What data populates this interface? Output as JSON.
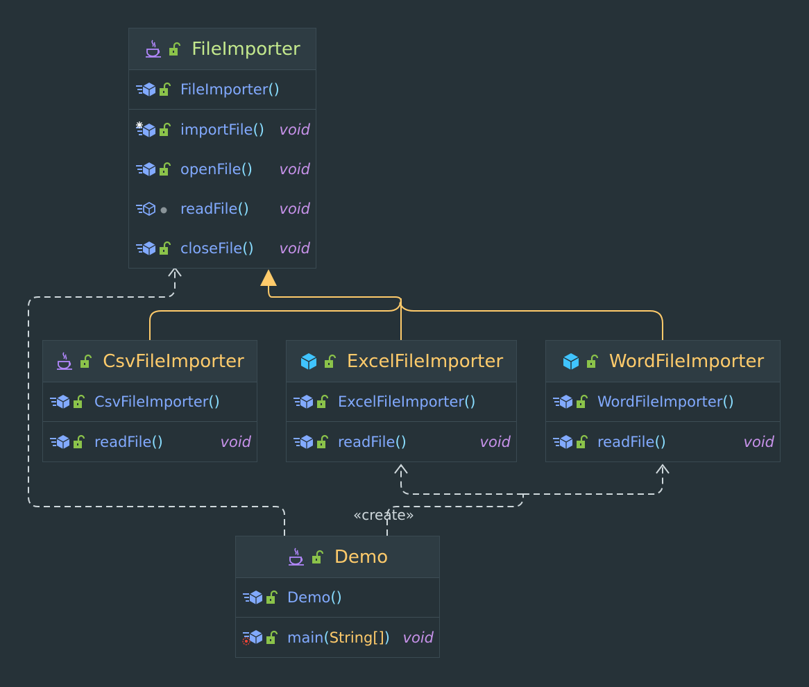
{
  "diagram": {
    "nodes": [
      {
        "id": "fileimporter",
        "name": "FileImporter",
        "kind": "abstract-class",
        "title_icon": "java-class-icon",
        "constructors": [
          {
            "name": "FileImporter",
            "params": "",
            "return": "",
            "method_icon": "method-icon",
            "visibility_icon": "public-lock-icon"
          }
        ],
        "methods": [
          {
            "name": "importFile",
            "params": "",
            "return": "void",
            "method_icon": "final-method-icon",
            "visibility_icon": "public-lock-icon"
          },
          {
            "name": "openFile",
            "params": "",
            "return": "void",
            "method_icon": "method-icon",
            "visibility_icon": "public-lock-icon"
          },
          {
            "name": "readFile",
            "params": "",
            "return": "void",
            "method_icon": "abstract-method-icon",
            "visibility_icon": "package-dot-icon"
          },
          {
            "name": "closeFile",
            "params": "",
            "return": "void",
            "method_icon": "method-icon",
            "visibility_icon": "public-lock-icon"
          }
        ]
      },
      {
        "id": "csvfileimporter",
        "name": "CsvFileImporter",
        "kind": "class",
        "title_icon": "java-class-icon",
        "constructors": [
          {
            "name": "CsvFileImporter",
            "params": "",
            "return": "",
            "method_icon": "method-icon",
            "visibility_icon": "public-lock-icon"
          }
        ],
        "methods": [
          {
            "name": "readFile",
            "params": "",
            "return": "void",
            "method_icon": "method-icon",
            "visibility_icon": "public-lock-icon"
          }
        ]
      },
      {
        "id": "excelfileimporter",
        "name": "ExcelFileImporter",
        "kind": "class",
        "title_icon": "class-cube-icon",
        "constructors": [
          {
            "name": "ExcelFileImporter",
            "params": "",
            "return": "",
            "method_icon": "method-icon",
            "visibility_icon": "public-lock-icon"
          }
        ],
        "methods": [
          {
            "name": "readFile",
            "params": "",
            "return": "void",
            "method_icon": "method-icon",
            "visibility_icon": "public-lock-icon"
          }
        ]
      },
      {
        "id": "wordfileimporter",
        "name": "WordFileImporter",
        "kind": "class",
        "title_icon": "class-cube-icon",
        "constructors": [
          {
            "name": "WordFileImporter",
            "params": "",
            "return": "",
            "method_icon": "method-icon",
            "visibility_icon": "public-lock-icon"
          }
        ],
        "methods": [
          {
            "name": "readFile",
            "params": "",
            "return": "void",
            "method_icon": "method-icon",
            "visibility_icon": "public-lock-icon"
          }
        ]
      },
      {
        "id": "demo",
        "name": "Demo",
        "kind": "class",
        "title_icon": "java-class-icon",
        "constructors": [
          {
            "name": "Demo",
            "params": "",
            "return": "",
            "method_icon": "method-icon",
            "visibility_icon": "public-lock-icon"
          }
        ],
        "methods": [
          {
            "name": "main",
            "params": "String[]",
            "return": "void",
            "method_icon": "static-main-method-icon",
            "visibility_icon": "public-lock-icon"
          }
        ]
      }
    ],
    "edges": [
      {
        "from": "csvfileimporter",
        "to": "fileimporter",
        "type": "generalization",
        "label": ""
      },
      {
        "from": "excelfileimporter",
        "to": "fileimporter",
        "type": "generalization",
        "label": ""
      },
      {
        "from": "wordfileimporter",
        "to": "fileimporter",
        "type": "generalization",
        "label": ""
      },
      {
        "from": "demo",
        "to": "fileimporter",
        "type": "dependency",
        "label": ""
      },
      {
        "from": "demo",
        "to": "excelfileimporter",
        "type": "dependency",
        "label": "«create»"
      },
      {
        "from": "demo",
        "to": "wordfileimporter",
        "type": "dependency",
        "label": "«create»"
      }
    ],
    "create_label": "«create»",
    "colors": {
      "background": "#263238",
      "title_bg": "#2e3c43",
      "border": "#3a4a52",
      "class_name": "#ffcb6b",
      "abstract_name": "#c3e88d",
      "method_name": "#82aaff",
      "return_type": "#c792ea",
      "param_type": "#ffcb6b",
      "paren": "#89ddff",
      "generalization_edge": "#ffcb6b",
      "dependency_edge": "#cfd8dc",
      "public_lock": "#8bc34a",
      "cube": "#40c4ff"
    }
  }
}
